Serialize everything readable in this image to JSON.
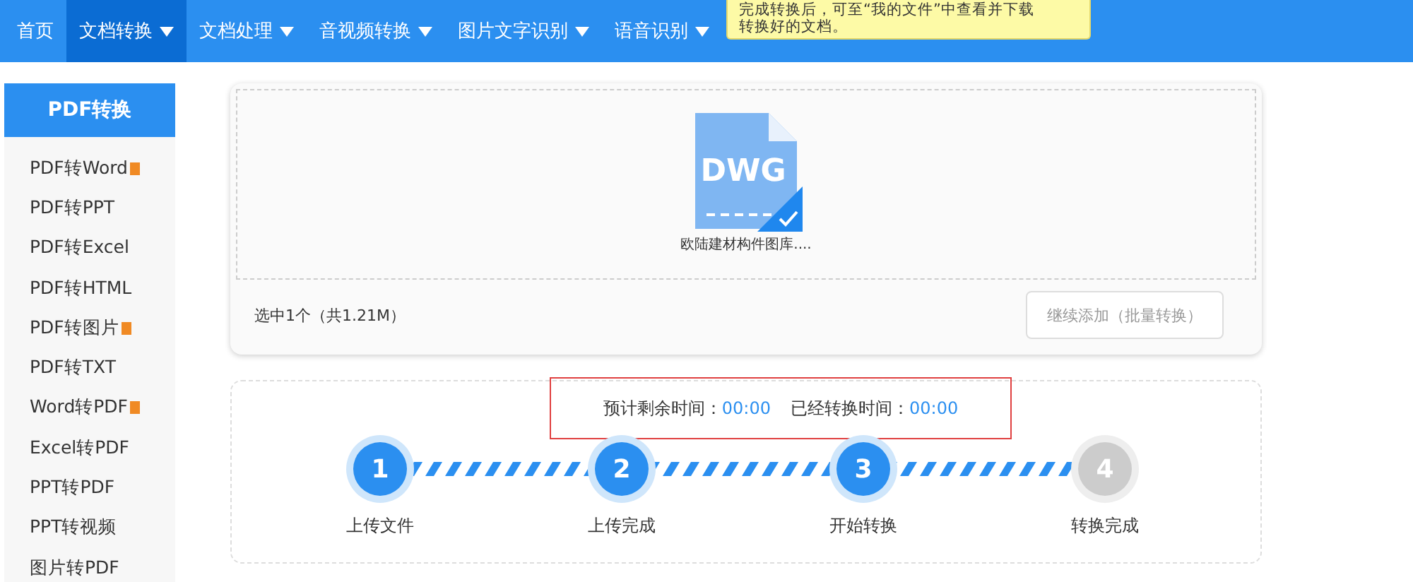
{
  "nav": {
    "items": [
      {
        "label": "首页",
        "selected": false,
        "dropdown": false
      },
      {
        "label": "文档转换",
        "selected": true,
        "dropdown": true
      },
      {
        "label": "文档处理",
        "selected": false,
        "dropdown": true
      },
      {
        "label": "音视频转换",
        "selected": false,
        "dropdown": true
      },
      {
        "label": "图片文字识别",
        "selected": false,
        "dropdown": true
      },
      {
        "label": "语音识别",
        "selected": false,
        "dropdown": true
      }
    ],
    "tooltip": [
      "完成转换后，可至“我的文件”中查看并下载",
      "转换好的文档。"
    ]
  },
  "sidebar": {
    "title": "PDF转换",
    "items": [
      {
        "label": "PDF转Word",
        "hot": true
      },
      {
        "label": "PDF转PPT",
        "hot": false
      },
      {
        "label": "PDF转Excel",
        "hot": false
      },
      {
        "label": "PDF转HTML",
        "hot": false
      },
      {
        "label": "PDF转图片",
        "hot": true
      },
      {
        "label": "PDF转TXT",
        "hot": false
      },
      {
        "label": "Word转PDF",
        "hot": true
      },
      {
        "label": "Excel转PDF",
        "hot": false
      },
      {
        "label": "PPT转PDF",
        "hot": false
      },
      {
        "label": "PPT转视频",
        "hot": false
      },
      {
        "label": "图片转PDF",
        "hot": false
      }
    ]
  },
  "upload": {
    "file": {
      "type": "DWG",
      "name": "欧陆建材构件图库....",
      "checked": true
    },
    "summary": "选中1个（共1.21M）",
    "add_button": "继续添加（批量转换）"
  },
  "progress": {
    "remaining_label": "预计剩余时间：",
    "remaining": "00:00",
    "elapsed_label": "已经转换时间：",
    "elapsed": "00:00",
    "steps": [
      {
        "number": "1",
        "label": "上传文件",
        "done": true
      },
      {
        "number": "2",
        "label": "上传完成",
        "done": true
      },
      {
        "number": "3",
        "label": "开始转换",
        "done": true
      },
      {
        "number": "4",
        "label": "转换完成",
        "done": false
      }
    ]
  }
}
